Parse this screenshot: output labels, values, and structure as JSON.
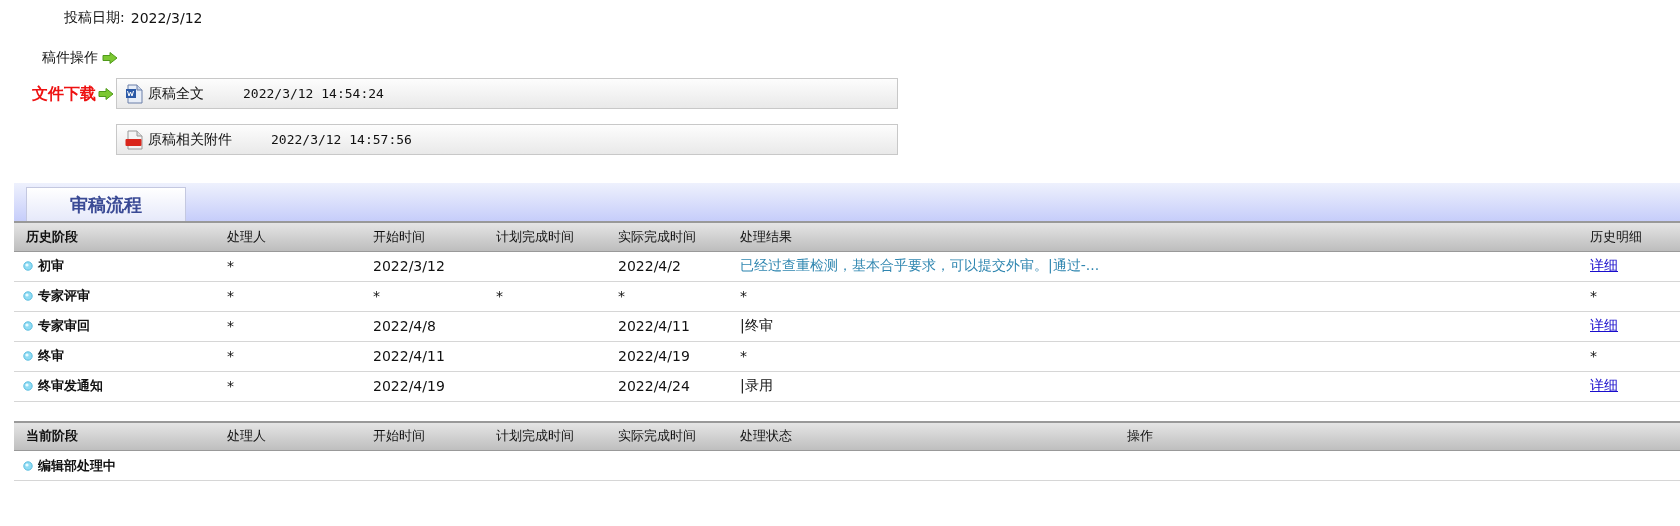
{
  "submission_date": {
    "label": "投稿日期:",
    "value": "2022/3/12"
  },
  "manuscript_actions": {
    "label": "稿件操作"
  },
  "downloads": {
    "label": "文件下载",
    "files": [
      {
        "kind": "word",
        "name": "原稿全文",
        "time": "2022/3/12 14:54:24"
      },
      {
        "kind": "pdf",
        "name": "原稿相关附件",
        "time": "2022/3/12 14:57:56"
      }
    ]
  },
  "tabs": [
    {
      "label": "审稿流程",
      "selected": true
    }
  ],
  "history_table": {
    "columns": [
      "历史阶段",
      "处理人",
      "开始时间",
      "计划完成时间",
      "实际完成时间",
      "处理结果",
      "历史明细"
    ],
    "rows": [
      {
        "stage": "初审",
        "handler": "*",
        "start": "2022/3/12",
        "planned": "",
        "actual": "2022/4/2",
        "result": {
          "text": "已经过查重检测，基本合乎要求，可以提交外审。|通过-...",
          "kind": "link"
        },
        "detail": {
          "text": "详细",
          "kind": "link"
        }
      },
      {
        "stage": "专家评审",
        "handler": "*",
        "start": "*",
        "planned": "*",
        "actual": "*",
        "result": {
          "text": "*",
          "kind": "text"
        },
        "detail": {
          "text": "*",
          "kind": "text"
        }
      },
      {
        "stage": "专家审回",
        "handler": "*",
        "start": "2022/4/8",
        "planned": "",
        "actual": "2022/4/11",
        "result": {
          "text": "|终审",
          "kind": "text"
        },
        "detail": {
          "text": "详细",
          "kind": "link"
        }
      },
      {
        "stage": "终审",
        "handler": "*",
        "start": "2022/4/11",
        "planned": "",
        "actual": "2022/4/19",
        "result": {
          "text": "*",
          "kind": "text"
        },
        "detail": {
          "text": "*",
          "kind": "text"
        }
      },
      {
        "stage": "终审发通知",
        "handler": "*",
        "start": "2022/4/19",
        "planned": "",
        "actual": "2022/4/24",
        "result": {
          "text": "|录用",
          "kind": "text"
        },
        "detail": {
          "text": "详细",
          "kind": "link"
        }
      }
    ]
  },
  "current_table": {
    "columns": [
      "当前阶段",
      "处理人",
      "开始时间",
      "计划完成时间",
      "实际完成时间",
      "处理状态",
      "操作"
    ],
    "rows": [
      {
        "stage": "编辑部处理中"
      }
    ]
  }
}
